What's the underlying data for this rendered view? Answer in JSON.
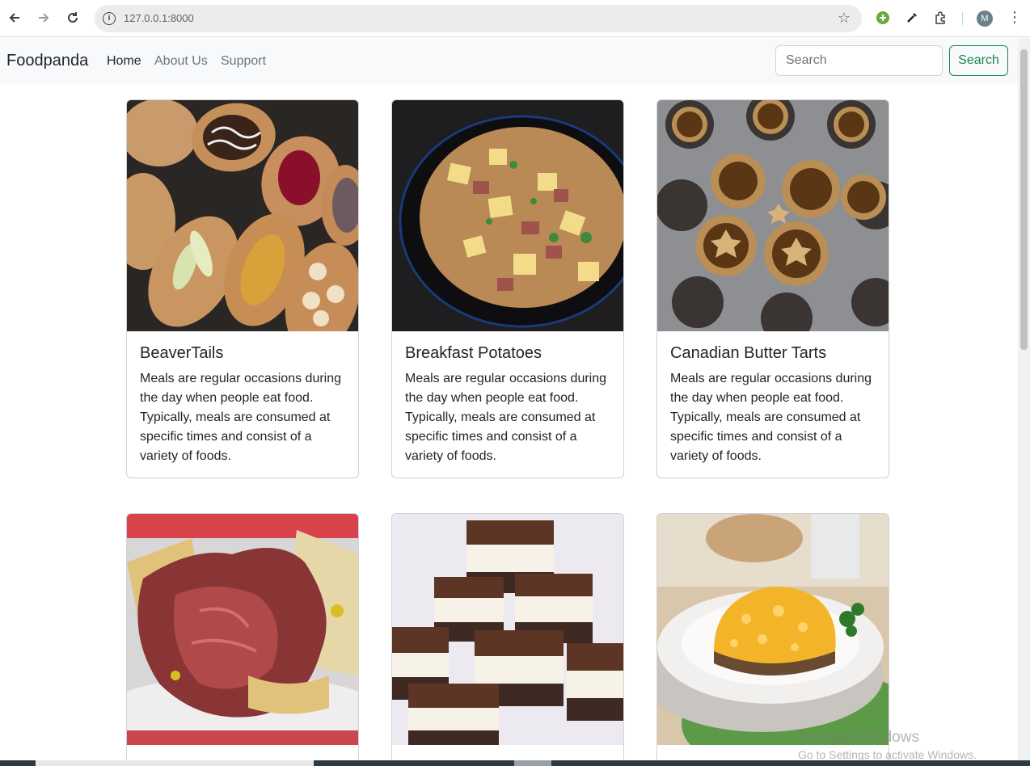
{
  "browser": {
    "url": "127.0.0.1:8000",
    "profile_initial": "M"
  },
  "navbar": {
    "brand": "Foodpanda",
    "links": [
      {
        "label": "Home",
        "active": true
      },
      {
        "label": "About Us",
        "active": false
      },
      {
        "label": "Support",
        "active": false
      }
    ],
    "search_placeholder": "Search",
    "search_button": "Search"
  },
  "cards": [
    {
      "title": "BeaverTails",
      "text": "Meals are regular occasions during the day when people eat food. Typically, meals are consumed at specific times and consist of a variety of foods.",
      "image": "beavertails-photo"
    },
    {
      "title": "Breakfast Potatoes",
      "text": "Meals are regular occasions during the day when people eat food. Typically, meals are consumed at specific times and consist of a variety of foods.",
      "image": "breakfast-potatoes-photo"
    },
    {
      "title": "Canadian Butter Tarts",
      "text": "Meals are regular occasions during the day when people eat food. Typically, meals are consumed at specific times and consist of a variety of foods.",
      "image": "butter-tarts-photo"
    },
    {
      "title": "",
      "text": "",
      "image": "smoked-meat-sandwich-photo"
    },
    {
      "title": "",
      "text": "",
      "image": "nanaimo-bars-photo"
    },
    {
      "title": "",
      "text": "",
      "image": "shepherds-pie-photo"
    }
  ],
  "watermark": {
    "line1": "Activate Windows",
    "line2": "Go to Settings to activate Windows."
  },
  "colors": {
    "success": "#198754",
    "navbar_bg": "#f8f9fa"
  }
}
